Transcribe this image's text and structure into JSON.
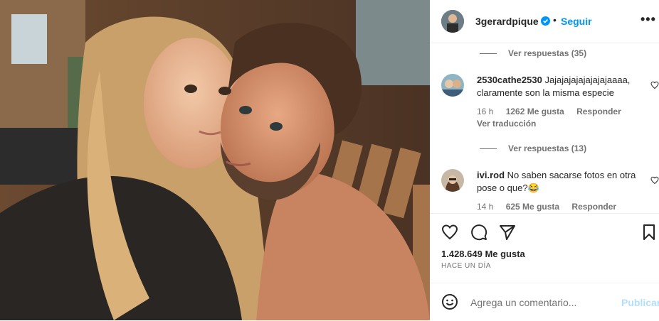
{
  "post": {
    "username": "3gerardpique",
    "follow_label": "Seguir",
    "dot": "•",
    "more": "•••"
  },
  "comments": [
    {
      "replies_label": "Ver respuestas (35)"
    },
    {
      "user": "2530cathe2530",
      "text": "Jajajajajajajajajaaaa, claramente son la misma especie",
      "age": "16 h",
      "likes": "1262 Me gusta",
      "reply": "Responder",
      "translate": "Ver traducción",
      "replies_label": "Ver respuestas (13)"
    },
    {
      "user": "ivi.rod",
      "text": "No saben sacarse fotos en otra pose o que?😂",
      "age": "14 h",
      "likes": "625 Me gusta",
      "reply": "Responder"
    }
  ],
  "actions": {
    "likes_count": "1.428.649 Me gusta",
    "posted": "HACE UN DÍA"
  },
  "composer": {
    "placeholder": "Agrega un comentario...",
    "publish": "Publicar"
  },
  "colors": {
    "accent": "#0095f6",
    "publish_disabled": "#b2dffc",
    "secondary_text": "#737373"
  }
}
